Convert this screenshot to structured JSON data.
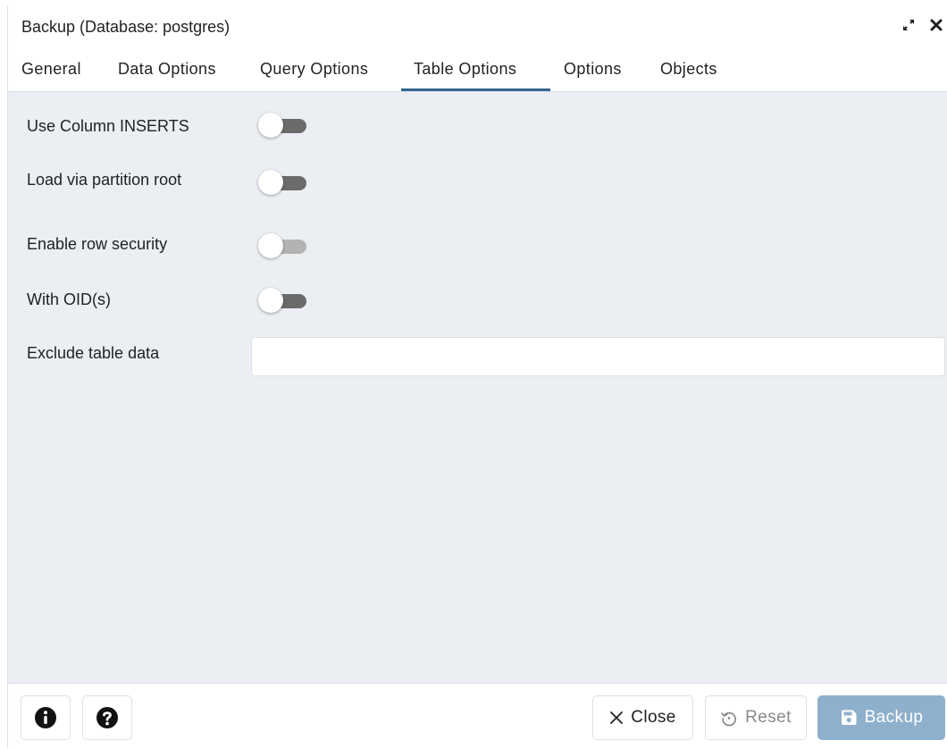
{
  "dialog": {
    "title": "Backup (Database: postgres)"
  },
  "tabs": [
    {
      "label": "General",
      "active": false
    },
    {
      "label": "Data Options",
      "active": false
    },
    {
      "label": "Query Options",
      "active": false
    },
    {
      "label": "Table Options",
      "active": true
    },
    {
      "label": "Options",
      "active": false
    },
    {
      "label": "Objects",
      "active": false
    }
  ],
  "fields": {
    "use_column_inserts": {
      "label": "Use Column INSERTS",
      "enabled": false
    },
    "load_via_partition_root": {
      "label": "Load via partition root",
      "enabled": false
    },
    "enable_row_security": {
      "label": "Enable row security",
      "enabled": false,
      "disabled": true
    },
    "with_oids": {
      "label": "With OID(s)",
      "enabled": false
    },
    "exclude_table_data": {
      "label": "Exclude table data",
      "value": "",
      "placeholder": ""
    }
  },
  "footer": {
    "close_label": "Close",
    "reset_label": "Reset",
    "backup_label": "Backup"
  },
  "icons": {
    "expand": "expand-icon",
    "close": "close-icon",
    "info": "info-icon",
    "help": "help-icon",
    "reset": "reset-icon",
    "save": "save-icon"
  },
  "colors": {
    "accent": "#326690",
    "primary_button_disabled": "#8fb0cc",
    "content_bg": "#ebeef3"
  }
}
